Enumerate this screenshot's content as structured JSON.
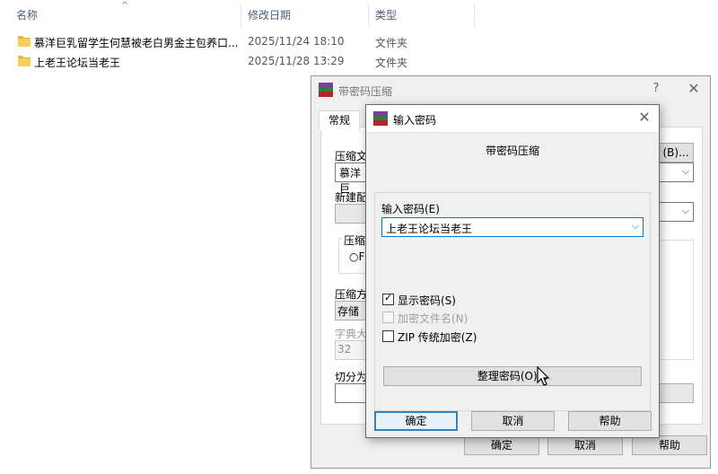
{
  "explorer": {
    "columns": {
      "name": "名称",
      "modified": "修改日期",
      "type": "类型"
    },
    "sort_indicator": "^",
    "rows": [
      {
        "name": "慕洋巨乳留学生何慧被老白男金主包养口...",
        "modified": "2025/11/24 18:10",
        "type": "文件夹"
      },
      {
        "name": "上老王论坛当老王",
        "modified": "2025/11/28 13:29",
        "type": "文件夹"
      }
    ]
  },
  "bg_dialog": {
    "title": "带密码压缩",
    "help_glyph": "?",
    "close_glyph": "✕",
    "tab_general": "常规",
    "label_archive_name": "压缩文",
    "archive_name_value": "慕洋巨",
    "label_new_profile": "新建配",
    "browse_button": "(B)...",
    "label_format": "压缩文",
    "format_radio": "F",
    "label_method": "压缩方",
    "method_value": "存储",
    "label_dict": "字典大",
    "dict_value": "32",
    "label_split": "切分为",
    "ok": "确定",
    "cancel": "取消",
    "help": "帮助"
  },
  "fg_dialog": {
    "title": "输入密码",
    "close_glyph": "✕",
    "header_text": "带密码压缩",
    "password_label": "输入密码(E)",
    "password_value": "上老王论坛当老王",
    "show_password": "显示密码(S)",
    "show_password_checked": true,
    "encrypt_filenames": "加密文件名(N)",
    "encrypt_filenames_checked": false,
    "zip_legacy": "ZIP 传统加密(Z)",
    "zip_legacy_checked": false,
    "organize_button": "整理密码(O)...",
    "ok": "确定",
    "cancel": "取消",
    "help": "帮助"
  },
  "colors": {
    "accent": "#0078d7",
    "folder": "#f7cf5a",
    "header_text": "#4c607a"
  }
}
